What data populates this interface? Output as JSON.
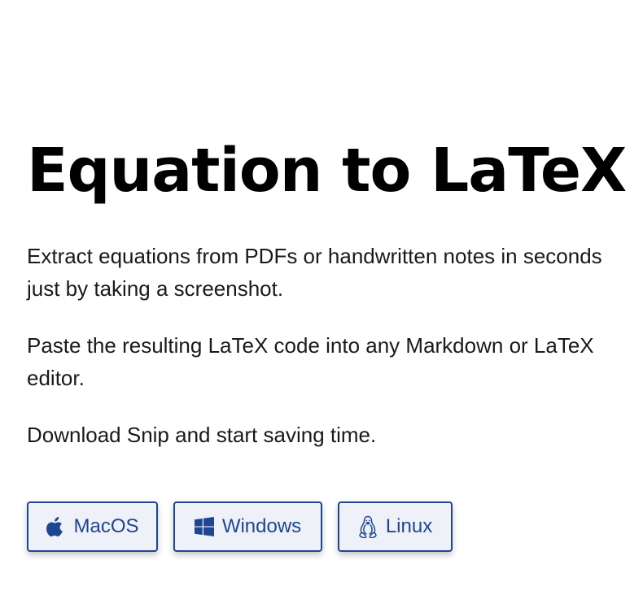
{
  "hero": {
    "title": "Equation to LaTeX",
    "paragraphs": [
      "Extract equations from PDFs or handwritten notes in seconds just by taking a screenshot.",
      "Paste the resulting LaTeX code into any Markdown or LaTeX editor.",
      "Download Snip and start saving time."
    ]
  },
  "downloads": {
    "buttons": [
      {
        "label": "MacOS",
        "icon": "apple-icon"
      },
      {
        "label": "Windows",
        "icon": "windows-icon"
      },
      {
        "label": "Linux",
        "icon": "linux-tux-icon"
      }
    ]
  },
  "colors": {
    "accent": "#1f4591",
    "button_background": "#eef1f7",
    "text": "#111111"
  }
}
